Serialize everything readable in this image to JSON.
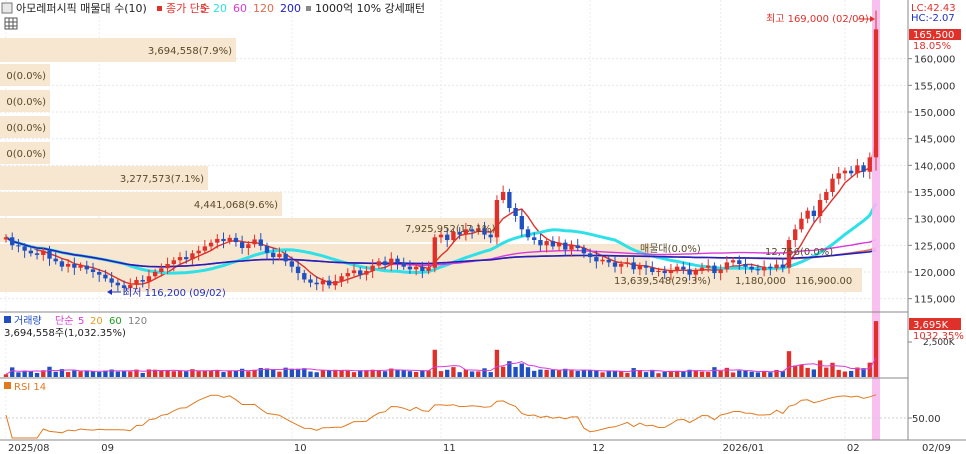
{
  "header": {
    "title": "아모레퍼시픽 매물대 수(10)",
    "ma_label": "종가 단순",
    "ma_periods": [
      "5",
      "20",
      "60",
      "120",
      "200"
    ],
    "ma_colors": [
      "#e0302a",
      "#2ee0e8",
      "#d93ad9",
      "#e06a50",
      "#2020c0"
    ],
    "pattern_label": "1000억 10% 강세패턴",
    "lc": "LC:42.43",
    "hc": "HC:-2.07"
  },
  "annotations": {
    "high_label": "최고 169,000 (02/09)",
    "low_label": "최저 116,200 (09/02)",
    "current_price": "165,500",
    "current_pct": "18.05%",
    "mid_labels": [
      "7,925,952(17.1%)",
      "매물대(0.0%)",
      "13,639,548(29.3%)",
      "116,900.00",
      "1,180,000",
      "12,756(0.0%)"
    ]
  },
  "volume_profile": [
    {
      "label": "3,694,558(7.9%)"
    },
    {
      "label": "0(0.0%)"
    },
    {
      "label": "0(0.0%)"
    },
    {
      "label": "0(0.0%)"
    },
    {
      "label": "0(0.0%)"
    },
    {
      "label": "3,277,573(7.1%)"
    },
    {
      "label": "4,441,068(9.6%)"
    }
  ],
  "volume_panel": {
    "title": "거래량",
    "ma_label": "단순",
    "ma_periods": [
      "5",
      "20",
      "60",
      "120"
    ],
    "ma_colors": [
      "#d93ad9",
      "#e0a020",
      "#20a020",
      "#808080"
    ],
    "info": "3,694,558주(1,032.35%)",
    "current": "3,695K",
    "current_pct": "1032.35%",
    "axis_tick": "2,500K"
  },
  "rsi_panel": {
    "title": "RSI 14",
    "axis_tick": "50.00"
  },
  "x_axis": {
    "labels": [
      "2025/08",
      "09",
      "10",
      "11",
      "12",
      "2026/01",
      "02",
      "02/09"
    ]
  },
  "chart_data": {
    "type": "candlestick",
    "y_axis": {
      "ticks": [
        115000,
        120000,
        125000,
        130000,
        135000,
        140000,
        145000,
        150000,
        155000,
        160000
      ],
      "tick_labels": [
        "115,000",
        "120,000",
        "125,000",
        "130,000",
        "135,000",
        "140,000",
        "145,000",
        "150,000",
        "155,000",
        "160,000"
      ],
      "ylim": [
        112500,
        171000
      ]
    },
    "x": [
      "2025/08",
      "09",
      "10",
      "11",
      "12",
      "2026/01",
      "02",
      "02/09"
    ],
    "close": [
      126500,
      125000,
      124800,
      124000,
      123500,
      123200,
      124000,
      122500,
      122000,
      121000,
      121500,
      120800,
      121200,
      120500,
      120000,
      119500,
      118800,
      118000,
      117500,
      117000,
      117600,
      118500,
      118200,
      119200,
      120000,
      120700,
      121500,
      122200,
      122800,
      122400,
      123500,
      124000,
      124800,
      125500,
      126200,
      125800,
      126400,
      125600,
      124500,
      125200,
      126100,
      124900,
      123600,
      122800,
      123400,
      122000,
      121000,
      119800,
      118600,
      118000,
      117700,
      118400,
      117500,
      118300,
      119200,
      119800,
      120300,
      119500,
      120200,
      121200,
      122000,
      121300,
      122500,
      121800,
      121000,
      120500,
      121000,
      120200,
      120800,
      126500,
      127000,
      126000,
      127500,
      127000,
      128000,
      127600,
      128200,
      127000,
      126500,
      133500,
      135000,
      132000,
      130500,
      128000,
      126500,
      126000,
      125000,
      125800,
      124800,
      125500,
      124200,
      125000,
      124500,
      123500,
      122800,
      122000,
      122300,
      121800,
      121000,
      121500,
      121800,
      120500,
      121200,
      120800,
      120000,
      120200,
      119800,
      120300,
      121000,
      120500,
      119500,
      120200,
      120800,
      121200,
      119800,
      120500,
      121800,
      122200,
      121500,
      121000,
      120500,
      120300,
      121000,
      120700,
      121400,
      120800,
      126000,
      128000,
      130000,
      131500,
      130500,
      133500,
      135000,
      137500,
      138500,
      139000,
      138500,
      140000,
      138800,
      141500,
      165500
    ],
    "ma_series": [
      {
        "name": "5",
        "color": "#e0302a"
      },
      {
        "name": "20",
        "color": "#2ee0e8"
      },
      {
        "name": "60",
        "color": "#d93ad9"
      },
      {
        "name": "120",
        "color": "#e06a50"
      },
      {
        "name": "200",
        "color": "#2020c0"
      }
    ],
    "high": {
      "value": 169000,
      "date": "02/09"
    },
    "low": {
      "value": 116200,
      "date": "09/02"
    },
    "grid": true
  }
}
